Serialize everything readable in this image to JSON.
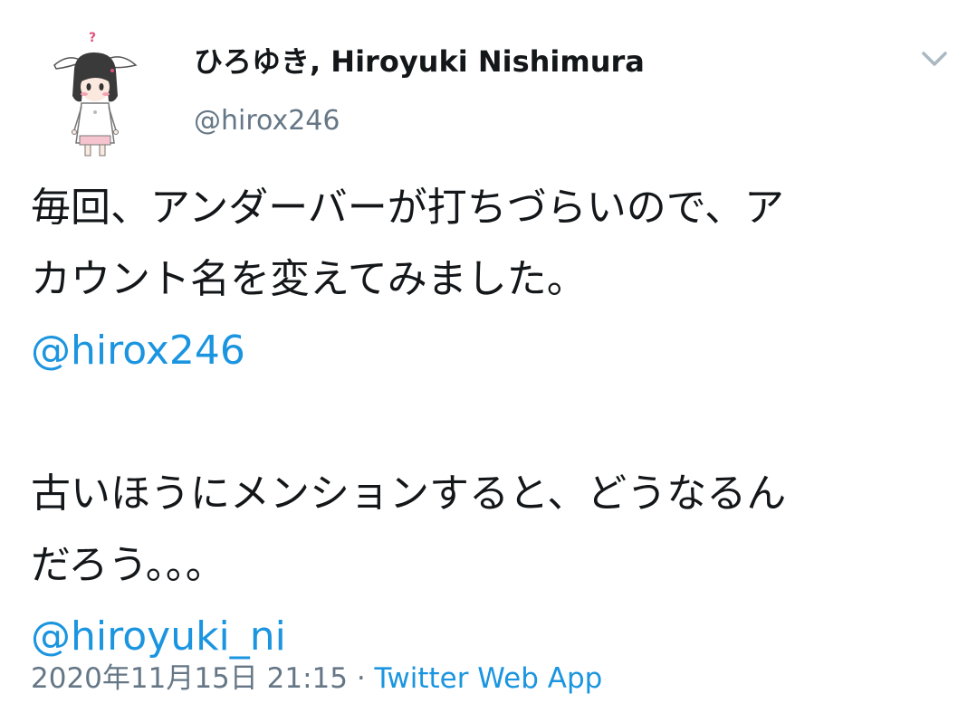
{
  "user": {
    "display_name": "ひろゆき, Hiroyuki Nishimura",
    "handle": "@hirox246",
    "avatar_icon": "character-avatar-icon"
  },
  "menu": {
    "icon": "chevron-down-icon"
  },
  "tweet": {
    "line1": "毎回、アンダーバーが打ちづらいので、ア",
    "line2": "カウント名を変えてみました。",
    "mention1": "@hirox246",
    "line3": "古いほうにメンションすると、どうなるん",
    "line4": "だろう。。。",
    "mention2": "@hiroyuki_ni"
  },
  "meta": {
    "timestamp": "2020年11月15日 21:15",
    "separator": " · ",
    "source": "Twitter Web App"
  },
  "colors": {
    "text": "#14171a",
    "secondary": "#657786",
    "link": "#1b95e0",
    "background": "#ffffff"
  }
}
